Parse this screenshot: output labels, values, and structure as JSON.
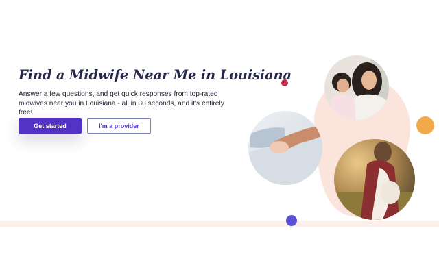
{
  "hero": {
    "headline": "Find a Midwife Near Me in Louisiana",
    "subtext": "Answer a few questions, and get quick responses from top-rated midwives near you in Louisiana - all in 30 seconds, and it's entirely free!",
    "primary_button": "Get started",
    "secondary_button": "I'm a provider"
  },
  "colors": {
    "headline": "#27294a",
    "primary": "#5233c6",
    "blob": "#fbe4dc",
    "dot_red": "#c4304f",
    "dot_orange": "#f1a94a",
    "dot_purple": "#5b4fd6",
    "band": "#fbf0ea"
  },
  "images": {
    "mother_child": "mother-and-child-photo",
    "baby_hand": "baby-hand-photo",
    "pregnant_woman": "pregnant-woman-photo"
  }
}
